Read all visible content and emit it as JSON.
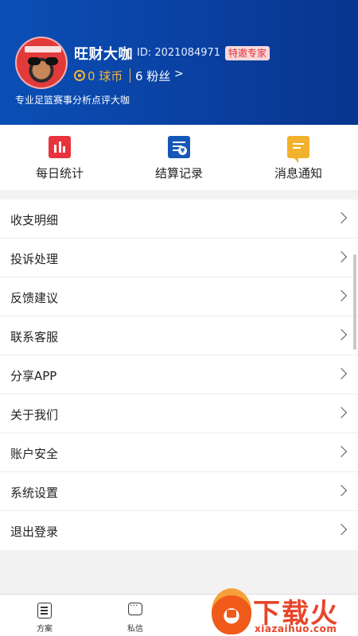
{
  "profile": {
    "name": "旺财大咖",
    "id_text": "ID: 2021084971",
    "badge": "特邀专家",
    "coins": "0 球币",
    "fans": "6 粉丝",
    "fans_chevron": ">",
    "bio": "专业足篮赛事分析点评大咖"
  },
  "shortcuts": [
    {
      "label": "每日统计",
      "icon": "bar-chart-icon"
    },
    {
      "label": "结算记录",
      "icon": "settlement-record-icon"
    },
    {
      "label": "消息通知",
      "icon": "message-notification-icon"
    }
  ],
  "menu": [
    {
      "label": "收支明细"
    },
    {
      "label": "投诉处理"
    },
    {
      "label": "反馈建议"
    },
    {
      "label": "联系客服"
    },
    {
      "label": "分享APP"
    },
    {
      "label": "关于我们"
    },
    {
      "label": "账户安全"
    },
    {
      "label": "系统设置"
    },
    {
      "label": "退出登录"
    }
  ],
  "bottom_nav": [
    {
      "label": "方案",
      "icon": "document-icon"
    },
    {
      "label": "私信",
      "icon": "chat-icon"
    }
  ],
  "watermark": {
    "text": "下载火",
    "url": "xiazaihuo.com"
  },
  "colors": {
    "header_bg": "#0a4fb6",
    "coin": "#f1b53c",
    "badge_text": "#e0303a",
    "stats_icon": "#e8333c",
    "settle_icon": "#1457b8",
    "msg_icon": "#f2b12c"
  }
}
